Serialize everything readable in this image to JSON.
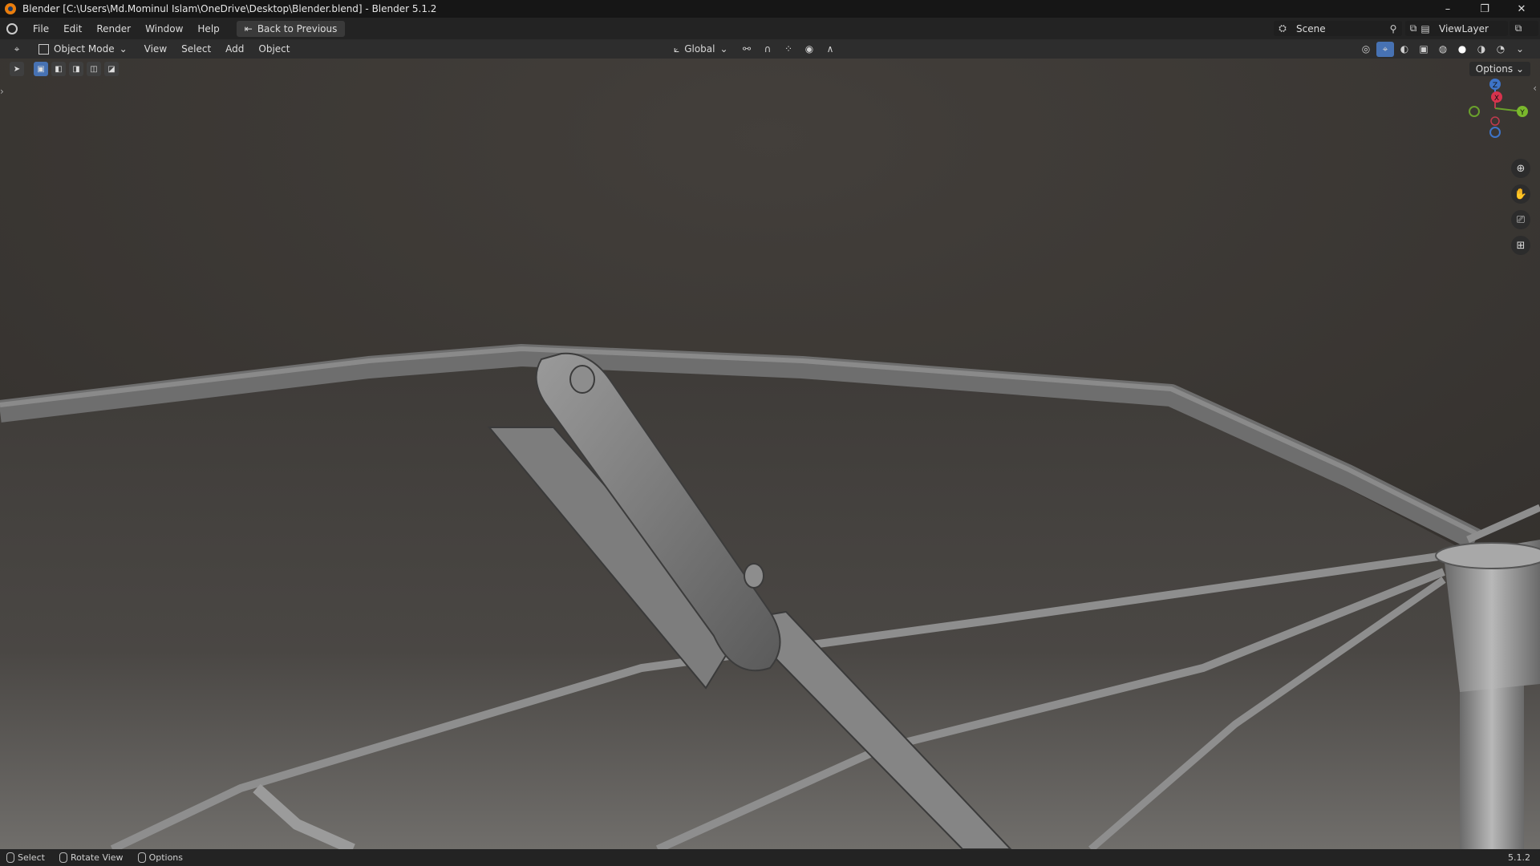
{
  "window": {
    "title": "Blender [C:\\Users\\Md.Mominul Islam\\OneDrive\\Desktop\\Blender.blend] - Blender 5.1.2",
    "controls": [
      "–",
      "❐",
      "✕"
    ]
  },
  "topbar": {
    "menus": [
      "File",
      "Edit",
      "Render",
      "Window",
      "Help"
    ],
    "back_button": "Back to Previous",
    "scene": "Scene",
    "view_layer": "ViewLayer"
  },
  "viewport_header": {
    "mode": "Object Mode",
    "menus": [
      "View",
      "Select",
      "Add",
      "Object"
    ],
    "transform_orientation": "Global",
    "options": "Options"
  },
  "gizmo": {
    "z": "Z",
    "x": "X",
    "y": "Y"
  },
  "statusbar": {
    "items": [
      "Select",
      "Rotate View",
      "Options"
    ],
    "version": "5.1.2"
  },
  "colors": {
    "accent": "#4772b3",
    "background": "#3a3734"
  }
}
